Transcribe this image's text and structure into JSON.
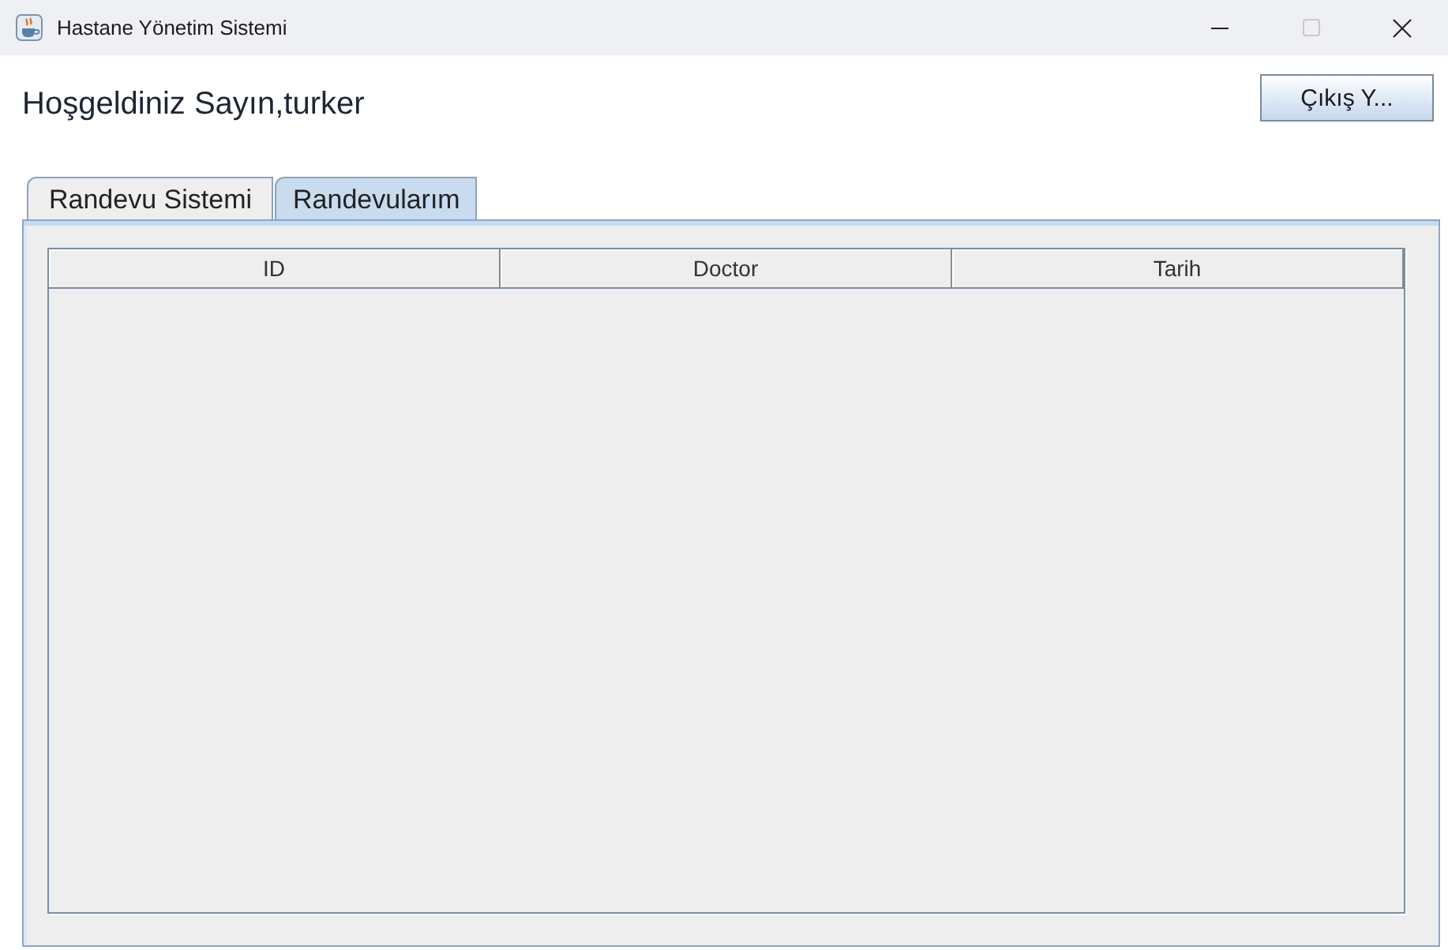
{
  "window": {
    "title": "Hastane Yönetim Sistemi",
    "maximizable": false
  },
  "header": {
    "greeting": "Hoşgeldiniz Sayın,turker",
    "logout_button": "Çıkış Y..."
  },
  "tabs": [
    {
      "label": "Randevu Sistemi",
      "selected": false
    },
    {
      "label": "Randevularım",
      "selected": true
    }
  ],
  "table": {
    "columns": [
      "ID",
      "Doctor",
      "Tarih"
    ]
  }
}
